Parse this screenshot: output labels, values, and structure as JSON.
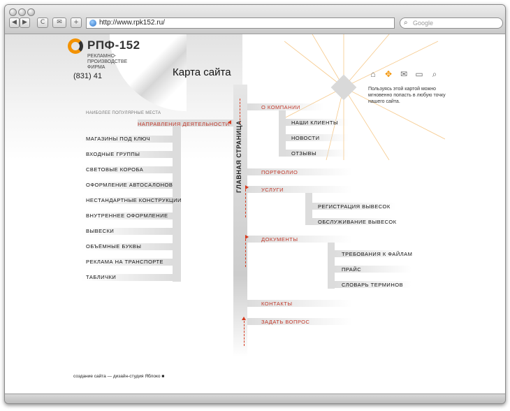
{
  "browser": {
    "url": "http://www.rpk152.ru/",
    "search_placeholder": "Google",
    "back_label": "◀",
    "forward_label": "▶",
    "reload_label": "C",
    "add_label": "+"
  },
  "header": {
    "logo_text": "РПФ-152",
    "logo_sub_1": "РЕКЛАМНО-",
    "logo_sub_2": "ПРОИЗВОДСТВЕ",
    "logo_sub_3": "ФИРМА",
    "phone": "(831) 41",
    "title": "Карта сайта"
  },
  "toolbar": {
    "hint": "Пользуясь этой картой можно мгновенно попасть в любую точку нашего сайта."
  },
  "sitemap": {
    "popular": "НАИБОЛЕЕ ПОПУЛЯРНЫЕ МЕСТА",
    "main": "ГЛАВНАЯ СТРАНИЦА",
    "directions": "НАПРАВЛЕНИЯ ДЕЯТЕЛЬНОСТИ",
    "left_items": [
      "МАГАЗИНЫ ПОД КЛЮЧ",
      "ВХОДНЫЕ ГРУППЫ",
      "СВЕТОВЫЕ КОРОБА",
      "ОФОРМЛЕНИЕ АВТОСАЛОНОВ",
      "НЕСТАНДАРТНЫЕ КОНСТРУКЦИИ",
      "ВНУТРЕННЕЕ ОФОРМЛЕНИЕ",
      "ВЫВЕСКИ",
      "ОБЪЁМНЫЕ БУКВЫ",
      "РЕКЛАМА НА ТРАНСПОРТЕ",
      "ТАБЛИЧКИ"
    ],
    "about": "О КОМПАНИИ",
    "about_items": [
      "НАШИ КЛИЕНТЫ",
      "НОВОСТИ",
      "ОТЗЫВЫ"
    ],
    "portfolio": "ПОРТФОЛИО",
    "services": "УСЛУГИ",
    "services_items": [
      "РЕГИСТРАЦИЯ ВЫВЕСОК",
      "ОБСЛУЖИВАНИЕ ВЫВЕСОК"
    ],
    "documents": "ДОКУМЕНТЫ",
    "documents_items": [
      "ТРЕБОВАНИЯ К ФАЙЛАМ",
      "ПРАЙС",
      "СЛОВАРЬ ТЕРМИНОВ"
    ],
    "contacts": "КОНТАКТЫ",
    "ask": "ЗАДАТЬ ВОПРОС"
  },
  "footer": {
    "credit": "создание сайта — дизайн-студия Яблоко"
  },
  "colors": {
    "accent": "#f39200",
    "link_red": "#c0392b",
    "bar_grey": "#dcdcdc"
  }
}
